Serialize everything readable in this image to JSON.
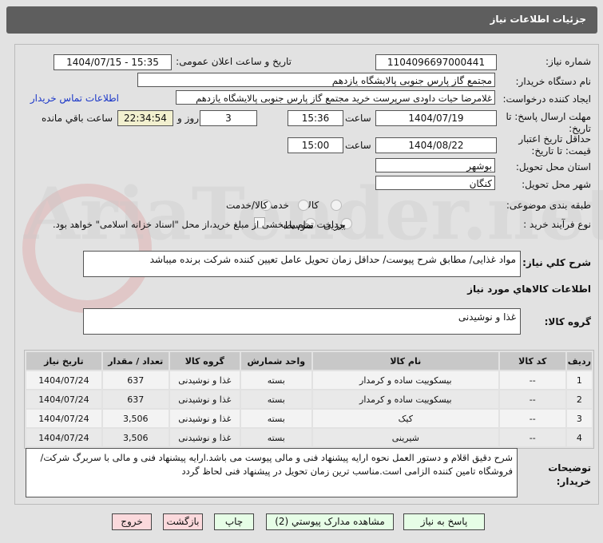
{
  "header": {
    "title": "جزئیات اطلاعات نیاز"
  },
  "form": {
    "need_number_label": "شماره نیاز:",
    "need_number": "1104096697000441",
    "announce_label": "تاریخ و ساعت اعلان عمومی:",
    "announce_value": "1404/07/15 - 15:35",
    "buyer_label": "نام دستگاه خریدار:",
    "buyer": "مجتمع گاز پارس جنوبی  پالایشگاه یازدهم",
    "creator_label": "ایجاد کننده درخواست:",
    "creator": "غلامرضا حیات داودی سرپرست خرید مجتمع گاز پارس جنوبی  پالایشگاه یازدهم",
    "contact_link": "اطلاعات تماس خریدار",
    "deadline_label": "مهلت ارسال پاسخ: تا تاریخ:",
    "deadline_date": "1404/07/19",
    "time_label": "ساعت",
    "deadline_time": "15:36",
    "days": "3",
    "days_label": "روز و",
    "remaining": "22:34:54",
    "remaining_label": "ساعت باقي مانده",
    "validity_label": "حداقل تاریخ اعتبار قیمت: تا تاریخ:",
    "validity_date": "1404/08/22",
    "validity_time": "15:00",
    "province_label": "استان محل تحویل:",
    "province": "بوشهر",
    "city_label": "شهر محل تحویل:",
    "city": "کنگان",
    "category_label": "طبقه بندی موضوعی:",
    "category_options": [
      "کالا",
      "خدمت",
      "کالا/خدمت"
    ],
    "process_label": "نوع فرآیند خرید :",
    "process_options": [
      "جزیی",
      "متوسط"
    ],
    "payment_note": "پرداخت تمام یا بخشی از مبلغ خرید،از محل \"اسناد خزانه اسلامی\" خواهد بود.",
    "summary_label": "شرح کلي نياز:",
    "summary": "مواد غذایی/ مطابق شرح پیوست/ حداقل زمان تحویل عامل تعیین کننده شرکت برنده میباشد",
    "goods_info_title": "اطلاعات کالاهاي مورد نياز",
    "group_label": "گروه کالا:",
    "group": "غذا و نوشیدنی"
  },
  "table": {
    "headers": [
      "ردیف",
      "کد کالا",
      "نام کالا",
      "واحد شمارش",
      "گروه کالا",
      "تعداد / مقدار",
      "تاریخ نیاز"
    ],
    "rows": [
      [
        "1",
        "--",
        "بیسکوییت ساده و کرمدار",
        "بسته",
        "غذا و نوشیدنی",
        "637",
        "1404/07/24"
      ],
      [
        "2",
        "--",
        "بیسکوییت ساده و کرمدار",
        "بسته",
        "غذا و نوشیدنی",
        "637",
        "1404/07/24"
      ],
      [
        "3",
        "--",
        "کیک",
        "بسته",
        "غذا و نوشیدنی",
        "3,506",
        "1404/07/24"
      ],
      [
        "4",
        "--",
        "شیرینی",
        "بسته",
        "غذا و نوشیدنی",
        "3,506",
        "1404/07/24"
      ]
    ]
  },
  "notes": {
    "label": "توضیحات خریدار:",
    "text": "شرح دقیق اقلام و دستور العمل نحوه ارایه پیشنهاد فنی و مالی پیوست می باشد.ارایه پیشنهاد فنی و مالی با سربرگ شرکت/فروشگاه تامین کننده الزامی است.مناسب ترین زمان تحویل در پیشنهاد فنی لحاظ گردد"
  },
  "buttons": {
    "reply": "پاسخ به نیاز",
    "attachments": "مشاهده مدارک پیوستي (2)",
    "print": "چاپ",
    "back": "بازگشت",
    "exit": "خروج"
  },
  "watermark": "AriaTender.net"
}
